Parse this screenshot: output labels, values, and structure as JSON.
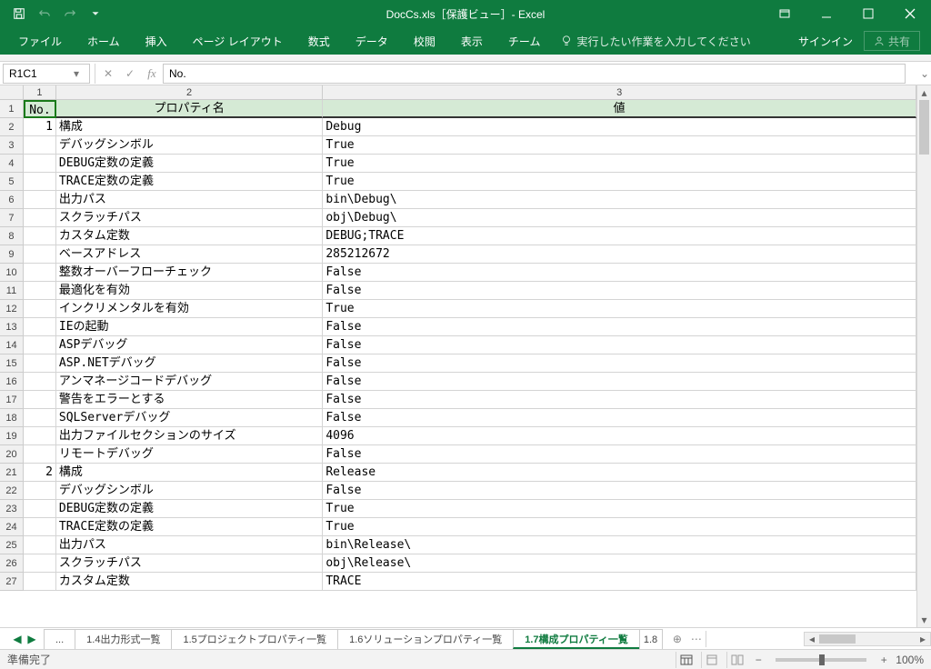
{
  "window": {
    "title": "DocCs.xls［保護ビュー］- Excel",
    "signin": "サインイン",
    "share": "共有"
  },
  "ribbon_tabs": [
    "ファイル",
    "ホーム",
    "挿入",
    "ページ レイアウト",
    "数式",
    "データ",
    "校閲",
    "表示",
    "チーム"
  ],
  "tellme": "実行したい作業を入力してください",
  "namebox": "R1C1",
  "formula": "No.",
  "col_headers": [
    "1",
    "2",
    "3"
  ],
  "header_row": {
    "no": "No.",
    "prop": "プロパティ名",
    "val": "値"
  },
  "rows": [
    {
      "r": "2",
      "no": "1",
      "prop": "構成",
      "val": "Debug"
    },
    {
      "r": "3",
      "no": "",
      "prop": "デバッグシンボル",
      "val": "True"
    },
    {
      "r": "4",
      "no": "",
      "prop": "DEBUG定数の定義",
      "val": "True"
    },
    {
      "r": "5",
      "no": "",
      "prop": "TRACE定数の定義",
      "val": "True"
    },
    {
      "r": "6",
      "no": "",
      "prop": "出力パス",
      "val": "bin\\Debug\\"
    },
    {
      "r": "7",
      "no": "",
      "prop": "スクラッチパス",
      "val": "obj\\Debug\\"
    },
    {
      "r": "8",
      "no": "",
      "prop": "カスタム定数",
      "val": "DEBUG;TRACE"
    },
    {
      "r": "9",
      "no": "",
      "prop": "ベースアドレス",
      "val": "285212672"
    },
    {
      "r": "10",
      "no": "",
      "prop": "整数オーバーフローチェック",
      "val": "False"
    },
    {
      "r": "11",
      "no": "",
      "prop": "最適化を有効",
      "val": "False"
    },
    {
      "r": "12",
      "no": "",
      "prop": "インクリメンタルを有効",
      "val": "True"
    },
    {
      "r": "13",
      "no": "",
      "prop": "IEの起動",
      "val": "False"
    },
    {
      "r": "14",
      "no": "",
      "prop": "ASPデバッグ",
      "val": "False"
    },
    {
      "r": "15",
      "no": "",
      "prop": "ASP.NETデバッグ",
      "val": "False"
    },
    {
      "r": "16",
      "no": "",
      "prop": "アンマネージコードデバッグ",
      "val": "False"
    },
    {
      "r": "17",
      "no": "",
      "prop": "警告をエラーとする",
      "val": "False"
    },
    {
      "r": "18",
      "no": "",
      "prop": "SQLServerデバッグ",
      "val": "False"
    },
    {
      "r": "19",
      "no": "",
      "prop": "出力ファイルセクションのサイズ",
      "val": "4096"
    },
    {
      "r": "20",
      "no": "",
      "prop": "リモートデバッグ",
      "val": "False"
    },
    {
      "r": "21",
      "no": "2",
      "prop": "構成",
      "val": "Release"
    },
    {
      "r": "22",
      "no": "",
      "prop": "デバッグシンボル",
      "val": "False"
    },
    {
      "r": "23",
      "no": "",
      "prop": "DEBUG定数の定義",
      "val": "True"
    },
    {
      "r": "24",
      "no": "",
      "prop": "TRACE定数の定義",
      "val": "True"
    },
    {
      "r": "25",
      "no": "",
      "prop": "出力パス",
      "val": "bin\\Release\\"
    },
    {
      "r": "26",
      "no": "",
      "prop": "スクラッチパス",
      "val": "obj\\Release\\"
    },
    {
      "r": "27",
      "no": "",
      "prop": "カスタム定数",
      "val": "TRACE"
    }
  ],
  "sheet_tabs": {
    "ellipsis": "...",
    "tabs": [
      "1.4出力形式一覧",
      "1.5プロジェクトプロパティ一覧",
      "1.6ソリューションプロパティ一覧",
      "1.7構成プロパティ一覧"
    ],
    "next_partial": "1.8",
    "active_index": 3
  },
  "status": {
    "ready": "準備完了",
    "zoom": "100%"
  }
}
